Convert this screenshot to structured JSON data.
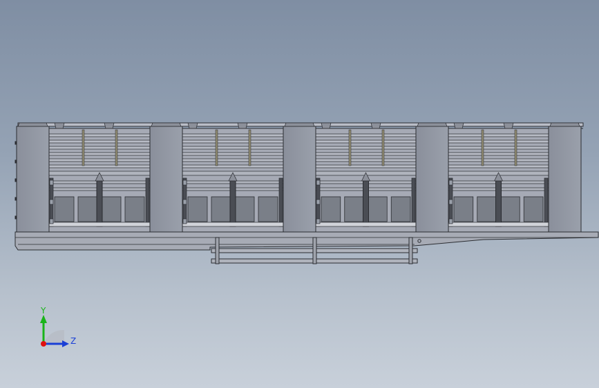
{
  "view": {
    "background_top": "#7f8ea3",
    "background_bottom": "#c8d0da",
    "model_fill": "#a6aab5",
    "panel_fill": "#8f94a0",
    "edge_color": "#2a2c31",
    "slot_fill": "#7a7f88"
  },
  "triad": {
    "y_label": "Y",
    "z_label": "Z",
    "y_color": "#19b419",
    "z_color": "#1a3fd6",
    "x_color": "#e01010"
  },
  "model": {
    "bay_count": 4,
    "pillar_count": 5,
    "stake_pockets": 3
  }
}
